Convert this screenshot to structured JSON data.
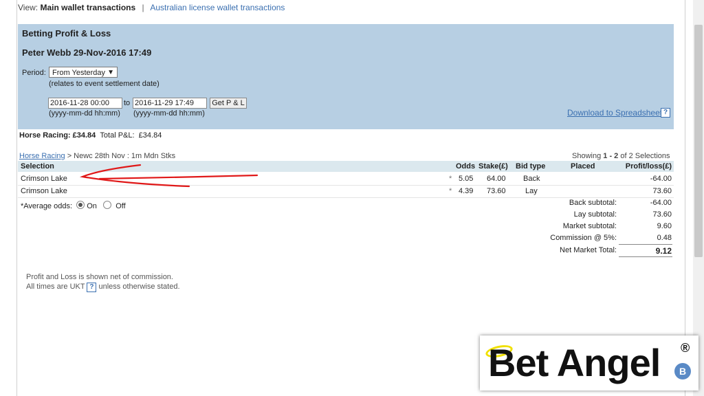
{
  "view": {
    "prefix": "View:",
    "main_wallet": "Main wallet transactions",
    "separator": "|",
    "au_wallet": "Australian license wallet transactions"
  },
  "report": {
    "title": "Betting Profit & Loss",
    "user_date": "Peter Webb 29-Nov-2016 17:49",
    "period_label": "Period:",
    "period_value": "From Yesterday",
    "period_note": "(relates to event settlement date)",
    "from_date": "2016-11-28 00:00",
    "to_label": "to",
    "to_date": "2016-11-29 17:49",
    "get_button": "Get P & L",
    "format_hint_from": "(yyyy-mm-dd hh:mm)",
    "format_hint_to": "(yyyy-mm-dd hh:mm)",
    "download_link": "Download to Spreadsheet",
    "help_glyph": "?"
  },
  "summary": {
    "sport_label": "Horse Racing: £34.84",
    "total_label": "Total P&L:",
    "total_value": "£34.84"
  },
  "breadcrumb": {
    "link": "Horse Racing",
    "rest": " > Newc 28th Nov : 1m Mdn Stks"
  },
  "showing": {
    "prefix": "Showing ",
    "range": "1 - 2",
    "suffix": " of 2 Selections"
  },
  "table": {
    "headers": {
      "selection": "Selection",
      "odds": "Odds",
      "stake": "Stake(£)",
      "bid_type": "Bid type",
      "placed": "Placed",
      "profit": "Profit/loss(£)"
    },
    "rows": [
      {
        "selection": "Crimson Lake",
        "star": "*",
        "odds": "5.05",
        "stake": "64.00",
        "bid_type": "Back",
        "placed": "",
        "profit": "-64.00"
      },
      {
        "selection": "Crimson Lake",
        "star": "*",
        "odds": "4.39",
        "stake": "73.60",
        "bid_type": "Lay",
        "placed": "",
        "profit": "73.60"
      }
    ]
  },
  "average_odds": {
    "label": "*Average odds:",
    "on": "On",
    "off": "Off",
    "selected": "On"
  },
  "subtotals": {
    "back_label": "Back subtotal:",
    "back_value": "-64.00",
    "lay_label": "Lay subtotal:",
    "lay_value": "73.60",
    "market_label": "Market subtotal:",
    "market_value": "9.60",
    "commission_label": "Commission @ 5%:",
    "commission_value": "0.48",
    "net_label": "Net Market Total:",
    "net_value": "9.12"
  },
  "footnote": {
    "line1": "Profit and Loss is shown net of commission.",
    "line2_prefix": "All times are UKT",
    "line2_suffix": "unless otherwise stated."
  },
  "logo": {
    "text": "Bet Angel",
    "reg": "®",
    "badge": "B"
  },
  "colors": {
    "panel": "#b7cfe3",
    "link": "#3a6fb0",
    "annotation": "#e01818",
    "halo": "#f0e000"
  }
}
